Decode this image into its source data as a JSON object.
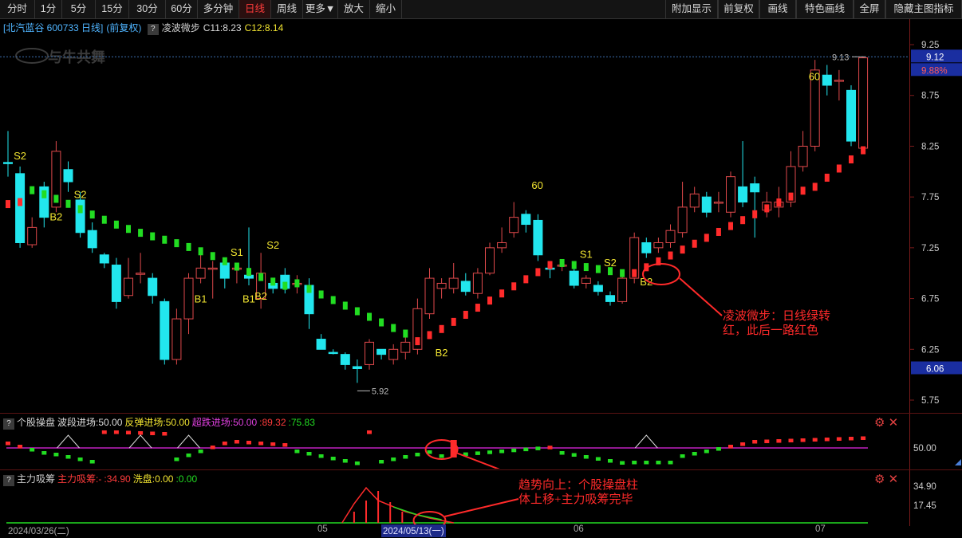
{
  "toolbar": {
    "left": [
      "分时",
      "1分",
      "5分",
      "15分",
      "30分",
      "60分",
      "多分钟",
      "日线",
      "周线",
      "更多▼",
      "放大",
      "缩小"
    ],
    "right": [
      "附加显示",
      "前复权",
      "画线",
      "特色画线",
      "全屏",
      "隐藏主图指标"
    ],
    "active": "日线"
  },
  "main_info": {
    "stock": "[北汽蓝谷 600733 日线]",
    "adjust": "(前复权)",
    "qmark": "?",
    "indicator": "凌波微步",
    "c11": "C11:8.23",
    "c12": "C12:8.14"
  },
  "watermark": "与牛共舞",
  "price_axis": {
    "ticks": [
      "9.25",
      "8.75",
      "8.25",
      "7.75",
      "7.25",
      "6.75",
      "6.25",
      "5.75"
    ],
    "high_label": "9.12",
    "pct_label": "9.88%",
    "current_label": "6.06",
    "high_marker": "9.13",
    "low_marker": "5.92"
  },
  "candle_labels": [
    {
      "text": "S2"
    },
    {
      "text": "B2"
    },
    {
      "text": "S2"
    },
    {
      "text": "B1"
    },
    {
      "text": "S1"
    },
    {
      "text": "B1"
    },
    {
      "text": "B2"
    },
    {
      "text": "S2"
    },
    {
      "text": "B2"
    },
    {
      "text": "60"
    },
    {
      "text": "S1"
    },
    {
      "text": "S2"
    },
    {
      "text": "B2"
    },
    {
      "text": "60"
    }
  ],
  "sub1_info": {
    "qmark": "?",
    "name": "个股操盘",
    "a": "波段进场:50.00",
    "b": "反弹进场:50.00",
    "c": "超跌进场:50.00",
    "d": ":89.32",
    "e": ":75.83",
    "level": "50.00"
  },
  "sub2_info": {
    "qmark": "?",
    "name": "主力吸筹",
    "a": "主力吸筹:-",
    "b": ":34.90",
    "c": "洗盘:0.00",
    "d": ":0.00",
    "tick_high": "34.90",
    "tick_mid": "17.45"
  },
  "panel_icons": {
    "gear": "gear-icon",
    "close": "close-icon"
  },
  "dates": [
    "2024/03/26(二)",
    "05",
    "2024/05/13(一)",
    "06",
    "07"
  ],
  "annotations": {
    "a1_line1": "凌波微步：日线绿转",
    "a1_line2": "红，此后一路红色",
    "a2_line1": "趋势向上：个股操盘柱",
    "a2_line2": "体上移+主力吸筹完毕"
  },
  "colors": {
    "up": "#ff2b2b",
    "down": "#22e6ee",
    "green": "#22dd22",
    "annotation": "#ff2a2a",
    "label": "#f2e531"
  },
  "chart_data": {
    "type": "candlestick",
    "period": "daily",
    "ylim": [
      5.75,
      9.25
    ],
    "candles": [
      {
        "o": 8.09,
        "c": 8.09,
        "h": 8.4,
        "l": 7.95
      },
      {
        "o": 7.98,
        "c": 7.3,
        "h": 8.05,
        "l": 7.25
      },
      {
        "o": 7.28,
        "c": 7.45,
        "h": 7.55,
        "l": 7.25
      },
      {
        "o": 7.85,
        "c": 7.55,
        "h": 7.9,
        "l": 7.45
      },
      {
        "o": 7.65,
        "c": 8.2,
        "h": 8.3,
        "l": 7.6
      },
      {
        "o": 8.02,
        "c": 7.9,
        "h": 8.1,
        "l": 7.8
      },
      {
        "o": 7.72,
        "c": 7.4,
        "h": 7.8,
        "l": 7.35
      },
      {
        "o": 7.42,
        "c": 7.25,
        "h": 7.5,
        "l": 7.2
      },
      {
        "o": 7.18,
        "c": 7.1,
        "h": 7.2,
        "l": 7.05
      },
      {
        "o": 7.08,
        "c": 6.72,
        "h": 7.15,
        "l": 6.65
      },
      {
        "o": 6.78,
        "c": 6.95,
        "h": 7.15,
        "l": 6.75
      },
      {
        "o": 7.0,
        "c": 7.0,
        "h": 7.2,
        "l": 6.9
      },
      {
        "o": 6.95,
        "c": 6.78,
        "h": 7.0,
        "l": 6.7
      },
      {
        "o": 6.72,
        "c": 6.15,
        "h": 6.75,
        "l": 6.1
      },
      {
        "o": 6.15,
        "c": 6.55,
        "h": 6.65,
        "l": 6.1
      },
      {
        "o": 6.55,
        "c": 6.95,
        "h": 7.0,
        "l": 6.4
      },
      {
        "o": 6.95,
        "c": 7.05,
        "h": 7.2,
        "l": 6.9
      },
      {
        "o": 7.05,
        "c": 7.05,
        "h": 7.12,
        "l": 6.75
      },
      {
        "o": 7.1,
        "c": 6.95,
        "h": 7.15,
        "l": 6.85
      },
      {
        "o": 7.05,
        "c": 7.05,
        "h": 7.1,
        "l": 6.9
      },
      {
        "o": 6.98,
        "c": 6.95,
        "h": 7.45,
        "l": 6.88
      },
      {
        "o": 6.75,
        "c": 7.0,
        "h": 7.2,
        "l": 6.65
      },
      {
        "o": 6.9,
        "c": 6.85,
        "h": 6.95,
        "l": 6.8
      },
      {
        "o": 6.98,
        "c": 6.85,
        "h": 7.05,
        "l": 6.8
      },
      {
        "o": 6.9,
        "c": 6.9,
        "h": 6.98,
        "l": 6.8
      },
      {
        "o": 6.88,
        "c": 6.6,
        "h": 6.95,
        "l": 6.45
      },
      {
        "o": 6.35,
        "c": 6.25,
        "h": 6.4,
        "l": 6.25
      },
      {
        "o": 6.22,
        "c": 6.22,
        "h": 6.25,
        "l": 6.2
      },
      {
        "o": 6.2,
        "c": 6.1,
        "h": 6.22,
        "l": 6.05
      },
      {
        "o": 6.08,
        "c": 6.06,
        "h": 6.15,
        "l": 5.92
      },
      {
        "o": 6.1,
        "c": 6.32,
        "h": 6.35,
        "l": 6.05
      },
      {
        "o": 6.25,
        "c": 6.2,
        "h": 6.25,
        "l": 6.15
      },
      {
        "o": 6.15,
        "c": 6.25,
        "h": 6.3,
        "l": 6.1
      },
      {
        "o": 6.22,
        "c": 6.32,
        "h": 6.4,
        "l": 6.15
      },
      {
        "o": 6.25,
        "c": 6.65,
        "h": 6.75,
        "l": 6.2
      },
      {
        "o": 6.6,
        "c": 6.95,
        "h": 7.05,
        "l": 6.55
      },
      {
        "o": 6.85,
        "c": 6.9,
        "h": 6.95,
        "l": 6.75
      },
      {
        "o": 6.85,
        "c": 6.95,
        "h": 7.1,
        "l": 6.8
      },
      {
        "o": 6.92,
        "c": 6.82,
        "h": 7.0,
        "l": 6.78
      },
      {
        "o": 6.8,
        "c": 7.0,
        "h": 7.05,
        "l": 6.75
      },
      {
        "o": 7.0,
        "c": 7.25,
        "h": 7.3,
        "l": 6.98
      },
      {
        "o": 7.25,
        "c": 7.3,
        "h": 7.45,
        "l": 7.2
      },
      {
        "o": 7.4,
        "c": 7.55,
        "h": 7.7,
        "l": 7.35
      },
      {
        "o": 7.58,
        "c": 7.48,
        "h": 7.62,
        "l": 7.4
      },
      {
        "o": 7.52,
        "c": 7.18,
        "h": 7.58,
        "l": 7.12
      },
      {
        "o": 7.05,
        "c": 7.05,
        "h": 7.08,
        "l": 6.95
      },
      {
        "o": 7.08,
        "c": 7.08,
        "h": 7.12,
        "l": 7.02
      },
      {
        "o": 7.02,
        "c": 6.88,
        "h": 7.05,
        "l": 6.85
      },
      {
        "o": 6.9,
        "c": 6.95,
        "h": 6.98,
        "l": 6.85
      },
      {
        "o": 6.88,
        "c": 6.82,
        "h": 6.92,
        "l": 6.78
      },
      {
        "o": 6.78,
        "c": 6.72,
        "h": 6.82,
        "l": 6.68
      },
      {
        "o": 6.72,
        "c": 6.95,
        "h": 7.0,
        "l": 6.7
      },
      {
        "o": 6.95,
        "c": 7.35,
        "h": 7.4,
        "l": 6.9
      },
      {
        "o": 7.3,
        "c": 7.2,
        "h": 7.35,
        "l": 7.15
      },
      {
        "o": 7.25,
        "c": 7.3,
        "h": 7.35,
        "l": 7.2
      },
      {
        "o": 7.3,
        "c": 7.42,
        "h": 7.48,
        "l": 7.25
      },
      {
        "o": 7.4,
        "c": 7.65,
        "h": 7.9,
        "l": 7.35
      },
      {
        "o": 7.65,
        "c": 7.78,
        "h": 7.85,
        "l": 7.6
      },
      {
        "o": 7.75,
        "c": 7.6,
        "h": 7.8,
        "l": 7.55
      },
      {
        "o": 7.7,
        "c": 7.7,
        "h": 7.8,
        "l": 7.6
      },
      {
        "o": 7.6,
        "c": 7.95,
        "h": 8.0,
        "l": 7.55
      },
      {
        "o": 7.85,
        "c": 7.7,
        "h": 8.3,
        "l": 7.65
      },
      {
        "o": 7.88,
        "c": 7.8,
        "h": 7.95,
        "l": 7.35
      },
      {
        "o": 7.62,
        "c": 7.7,
        "h": 7.8,
        "l": 7.55
      },
      {
        "o": 7.65,
        "c": 7.7,
        "h": 7.85,
        "l": 7.55
      },
      {
        "o": 7.7,
        "c": 8.05,
        "h": 8.2,
        "l": 7.65
      },
      {
        "o": 8.05,
        "c": 8.25,
        "h": 8.4,
        "l": 8.0
      },
      {
        "o": 8.25,
        "c": 9.0,
        "h": 9.1,
        "l": 8.2
      },
      {
        "o": 8.95,
        "c": 8.85,
        "h": 9.05,
        "l": 8.75
      },
      {
        "o": 8.9,
        "c": 8.9,
        "h": 9.0,
        "l": 8.7
      },
      {
        "o": 8.8,
        "c": 8.3,
        "h": 8.85,
        "l": 8.25
      },
      {
        "o": 8.23,
        "c": 9.12,
        "h": 9.13,
        "l": 8.2
      }
    ],
    "dates_shown": [
      "2024/03/26(二)",
      "05",
      "2024/05/13(一)",
      "06",
      "07"
    ]
  }
}
